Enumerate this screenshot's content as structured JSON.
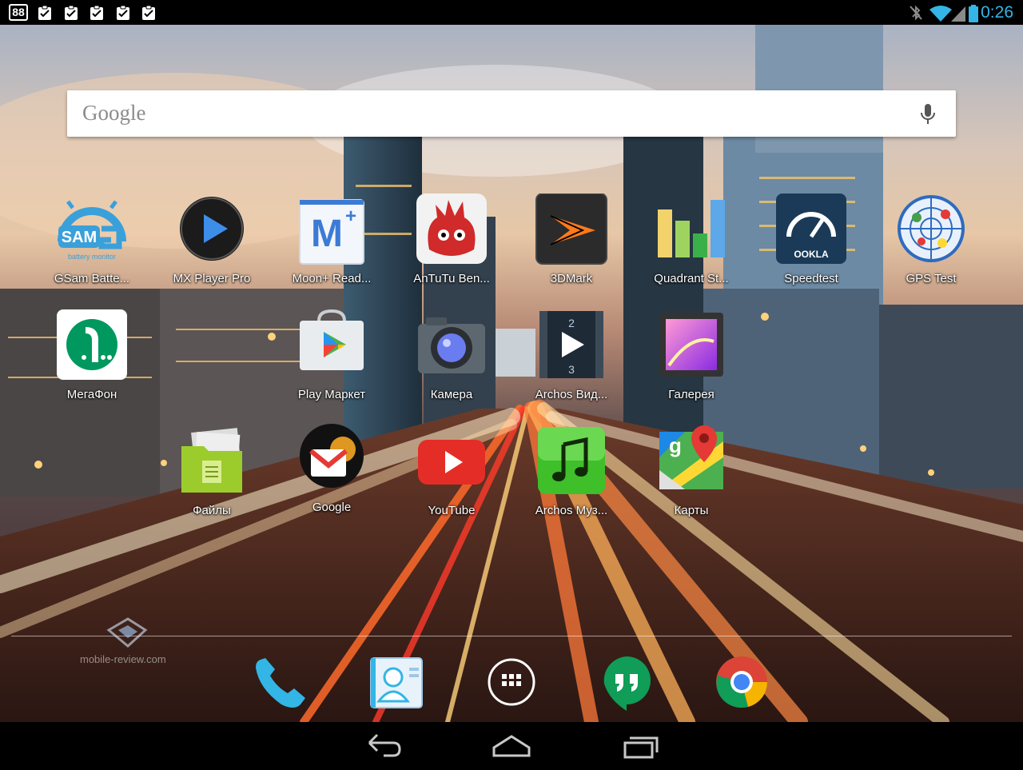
{
  "status_bar": {
    "notification_badge": "88",
    "notification_icons": [
      "clipboard-check-icon",
      "clipboard-check-icon",
      "clipboard-check-icon",
      "clipboard-check-icon",
      "clipboard-check-icon"
    ],
    "time": "0:26",
    "icons": [
      "bluetooth-off-icon",
      "wifi-icon",
      "cell-signal-icon",
      "battery-icon"
    ],
    "time_color": "#34b5e5"
  },
  "search": {
    "logo_text": "Google",
    "icon": "mic-icon"
  },
  "apps_row1": [
    {
      "label": "GSam Batte...",
      "icon": "gsam-battery-icon"
    },
    {
      "label": "MX Player Pro",
      "icon": "mx-player-icon"
    },
    {
      "label": "Moon+ Read...",
      "icon": "moon-reader-icon"
    },
    {
      "label": "AnTuTu Ben...",
      "icon": "antutu-icon"
    },
    {
      "label": "3DMark",
      "icon": "3dmark-icon"
    },
    {
      "label": "Quadrant St...",
      "icon": "quadrant-icon"
    },
    {
      "label": "Speedtest",
      "icon": "speedtest-icon"
    },
    {
      "label": "GPS Test",
      "icon": "gps-test-icon"
    }
  ],
  "apps_row2": [
    {
      "label": "МегаФон",
      "icon": "megafon-icon"
    },
    {
      "label": "Play Маркет",
      "icon": "play-store-icon"
    },
    {
      "label": "Камера",
      "icon": "camera-icon"
    },
    {
      "label": "Archos Вид...",
      "icon": "archos-video-icon"
    },
    {
      "label": "Галерея",
      "icon": "gallery-icon"
    }
  ],
  "apps_row3": [
    {
      "label": "Файлы",
      "icon": "files-icon"
    },
    {
      "label": "Google",
      "icon": "google-folder-icon"
    },
    {
      "label": "YouTube",
      "icon": "youtube-icon"
    },
    {
      "label": "Archos Муз...",
      "icon": "archos-music-icon"
    },
    {
      "label": "Карты",
      "icon": "maps-icon"
    }
  ],
  "dock": [
    "phone-icon",
    "contacts-icon",
    "all-apps-icon",
    "hangouts-icon",
    "chrome-icon"
  ],
  "nav": [
    "back-icon",
    "home-icon",
    "recents-icon"
  ],
  "watermark": "mobile-review.com",
  "colors": {
    "wifi": "#34b5e5",
    "youtube": "#e52d27",
    "megafon": "#00985f"
  }
}
